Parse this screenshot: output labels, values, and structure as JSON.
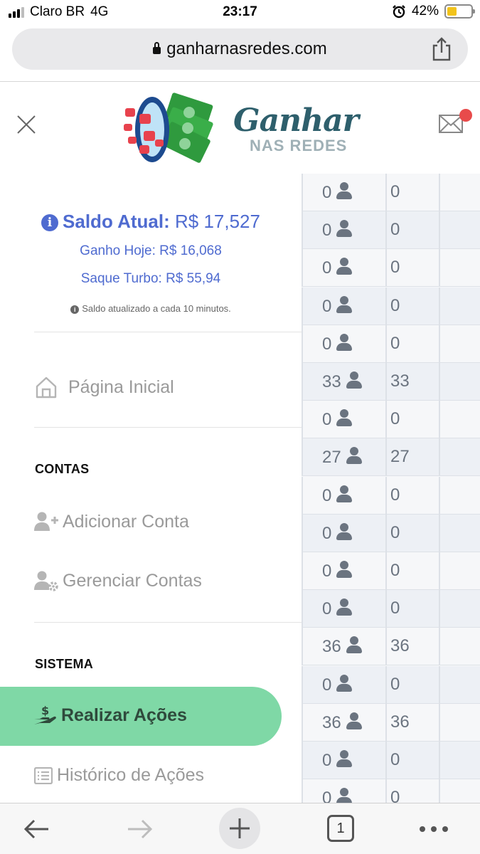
{
  "status_bar": {
    "carrier": "Claro BR",
    "network": "4G",
    "time": "23:17",
    "battery": "42%",
    "battery_level": 0.42
  },
  "browser": {
    "url": "ganharnasredes.com",
    "tab_count": "1"
  },
  "header": {
    "logo_title": "Ganhar",
    "logo_subtitle": "NAS REDES"
  },
  "balance": {
    "label": "Saldo Atual:",
    "value": "R$ 17,527",
    "ganho_hoje": "Ganho Hoje: R$ 16,068",
    "saque_turbo": "Saque Turbo: R$ 55,94",
    "note": "Saldo atualizado a cada 10 minutos."
  },
  "nav": {
    "home": "Página Inicial",
    "section_contas": "CONTAS",
    "add_account": "Adicionar Conta",
    "manage_accounts": "Gerenciar Contas",
    "section_sistema": "SISTEMA",
    "perform_actions": "Realizar Ações",
    "history": "Histórico de Ações"
  },
  "table": {
    "rows": [
      {
        "a": "0",
        "b": "0"
      },
      {
        "a": "0",
        "b": "0"
      },
      {
        "a": "0",
        "b": "0"
      },
      {
        "a": "0",
        "b": "0"
      },
      {
        "a": "0",
        "b": "0"
      },
      {
        "a": "33",
        "b": "33"
      },
      {
        "a": "0",
        "b": "0"
      },
      {
        "a": "27",
        "b": "27"
      },
      {
        "a": "0",
        "b": "0"
      },
      {
        "a": "0",
        "b": "0"
      },
      {
        "a": "0",
        "b": "0"
      },
      {
        "a": "0",
        "b": "0"
      },
      {
        "a": "36",
        "b": "36"
      },
      {
        "a": "0",
        "b": "0"
      },
      {
        "a": "36",
        "b": "36"
      },
      {
        "a": "0",
        "b": "0"
      },
      {
        "a": "0",
        "b": "0"
      }
    ]
  },
  "colors": {
    "accent_blue": "#4f6bd0",
    "active_green": "#7fd8a6",
    "notification_red": "#e84b4b",
    "battery_yellow": "#f2c31b"
  }
}
